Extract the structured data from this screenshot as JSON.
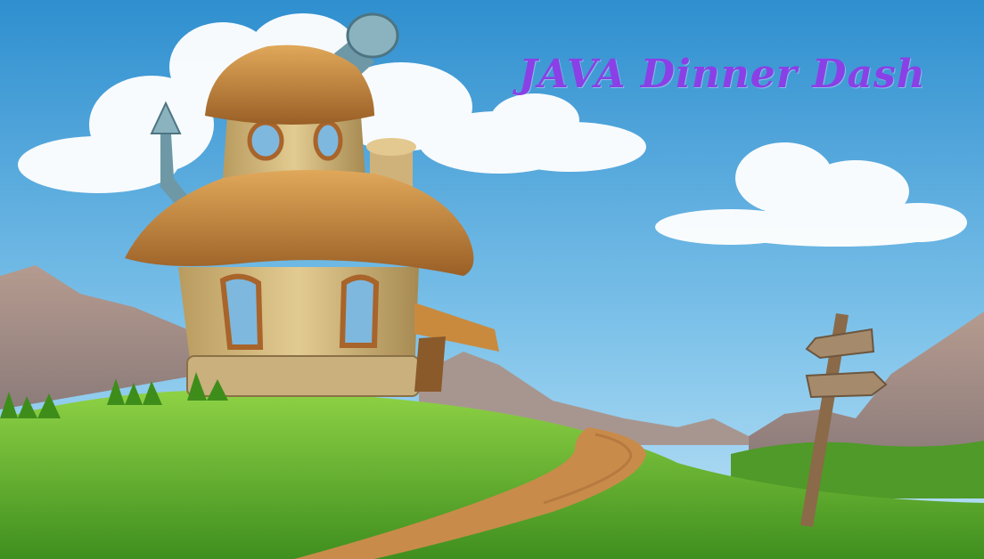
{
  "title": {
    "text": "JAVA Dinner Dash",
    "color": "#8a40e6"
  },
  "scene": {
    "background": "cartoon landscape",
    "elements": [
      "sky",
      "clouds",
      "mountains",
      "mushroom-house",
      "hill",
      "dirt-path",
      "signpost"
    ]
  },
  "colors": {
    "sky_top": "#2f8fcf",
    "sky_bottom": "#bfe3f6",
    "grass": "#5fb12c",
    "path": "#c98b4a",
    "roof": "#c98a3e",
    "wall": "#d9c087",
    "pipe": "#6e98a6"
  }
}
